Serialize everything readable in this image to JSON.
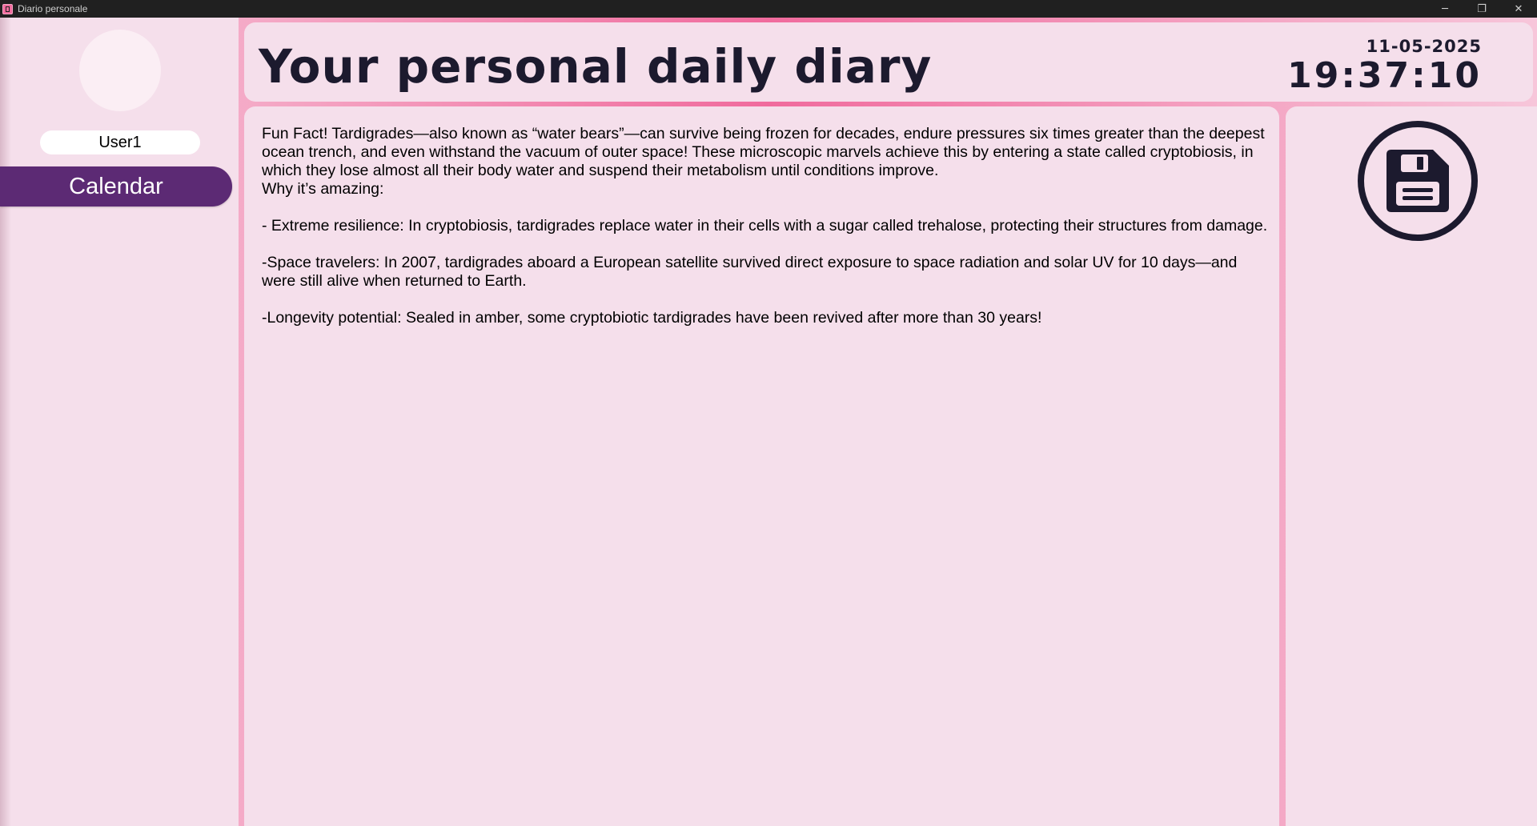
{
  "window": {
    "title": "Diario personale",
    "controls": {
      "minimize": "─",
      "maximize": "❐",
      "close": "✕"
    }
  },
  "sidebar": {
    "username": "User1",
    "calendar_label": "Calendar"
  },
  "header": {
    "title": "Your personal daily diary",
    "date": "11-05-2025",
    "time": "19:37:10"
  },
  "editor": {
    "paragraphs": [
      "Fun Fact! Tardigrades—also known as “water bears”—can survive being frozen for decades, endure pressures six times greater than the deepest ocean trench, and even withstand the vacuum of outer space! These microscopic marvels achieve this by entering a state called cryptobiosis, in which they lose almost all their body water and suspend their metabolism until conditions improve.",
      "Why it’s amazing:",
      "",
      "- Extreme resilience: In cryptobiosis, tardigrades replace water in their cells with a sugar called trehalose, protecting their structures from damage.",
      "",
      "-Space travelers: In 2007, tardigrades aboard a European satellite survived direct exposure to space radiation and solar UV for 10 days—and were still alive when returned to Earth.",
      "",
      "-Longevity potential: Sealed in amber, some cryptobiotic tardigrades have been revived after more than 30 years!"
    ]
  },
  "save": {
    "icon": "floppy-disk-icon"
  },
  "colors": {
    "accent_purple": "#5c2a74",
    "panel_pink": "#f5dfeb",
    "border_pink": "#f06b9d",
    "dark_text": "#1c1a2e"
  }
}
